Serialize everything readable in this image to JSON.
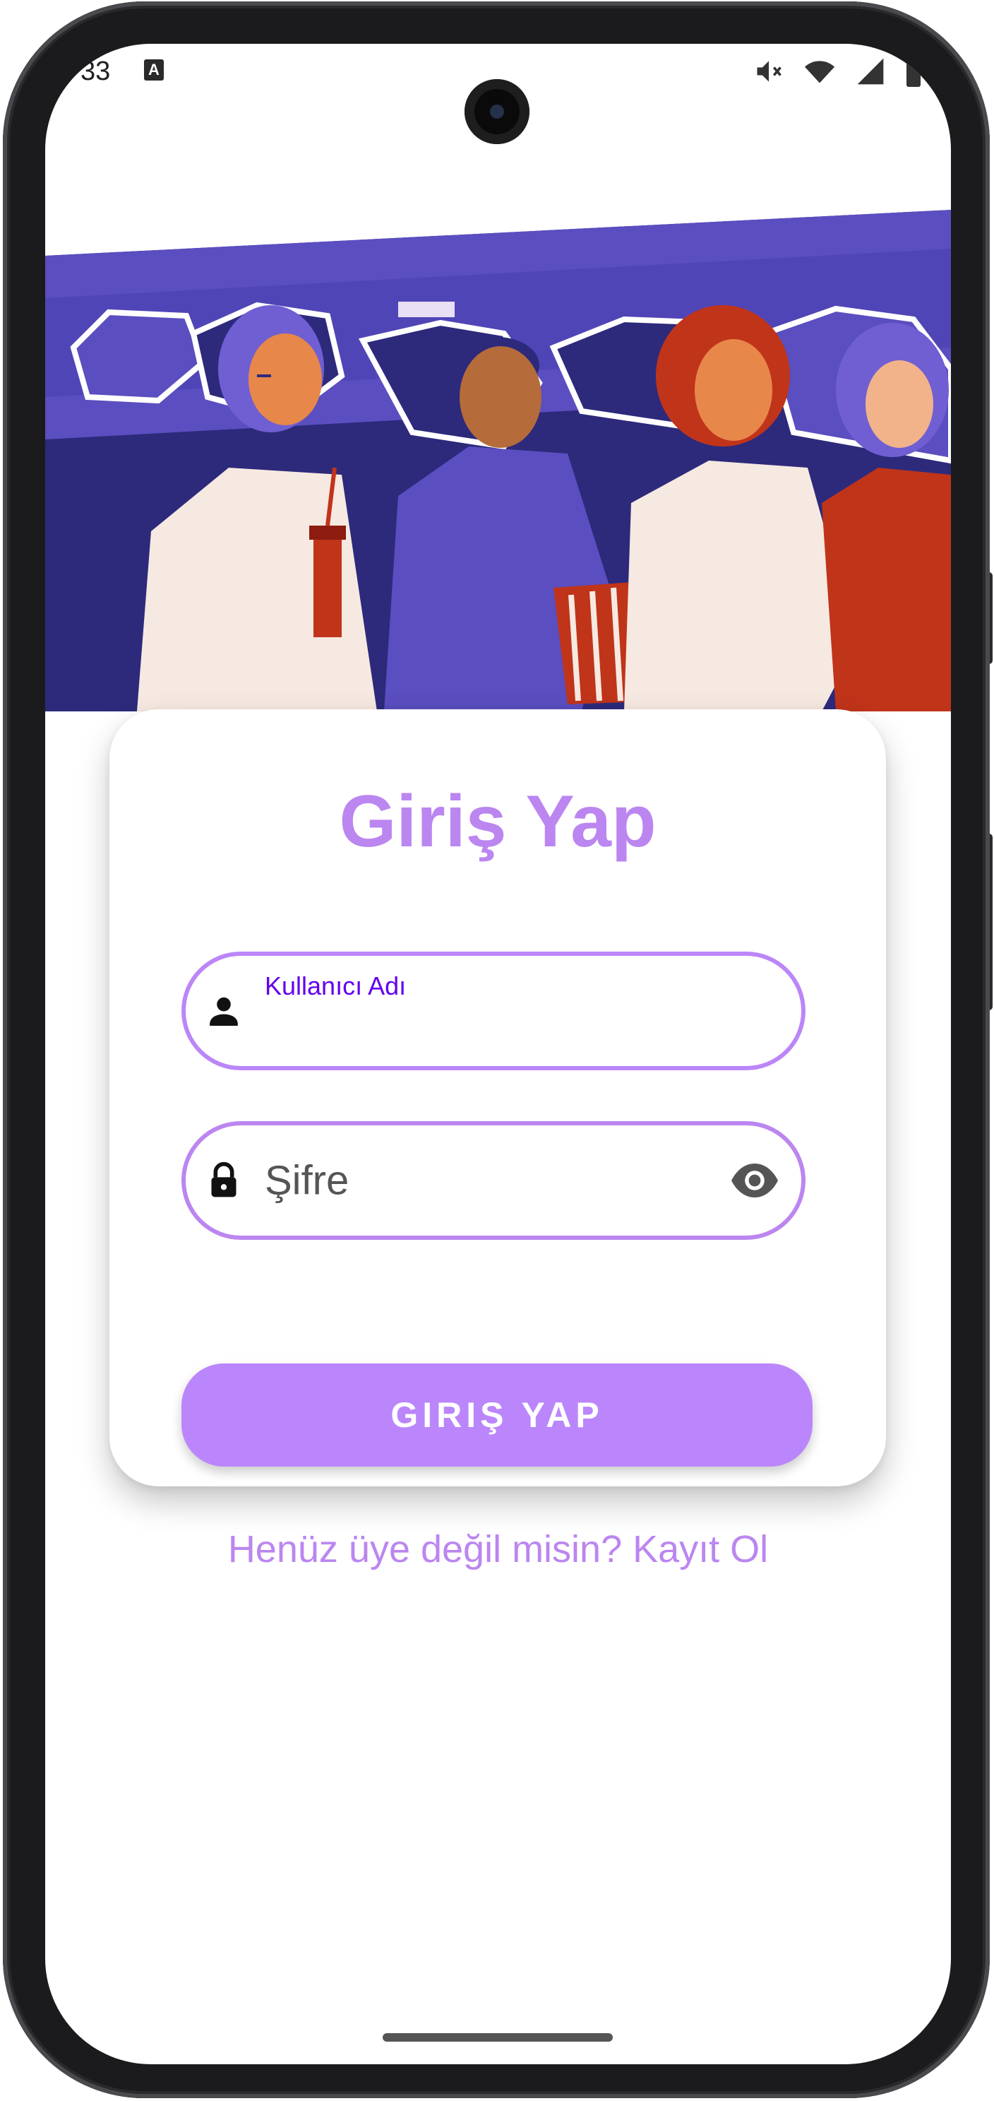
{
  "status_bar": {
    "time": "33",
    "keyboard_indicator": "A",
    "icons": [
      "mute-icon",
      "wifi-icon",
      "signal-icon",
      "battery-icon"
    ]
  },
  "hero": {
    "image": "cinema-audience-illustration",
    "colors": {
      "purple": "#5b4ec0",
      "dark": "#2d2a7c",
      "cream": "#f6e9e1",
      "skin": "#e8874a",
      "red": "#c0341a"
    }
  },
  "login": {
    "title": "Giriş Yap",
    "username": {
      "label": "Kullanıcı Adı",
      "value": "",
      "icon": "person-icon"
    },
    "password": {
      "placeholder": "Şifre",
      "value": "",
      "icon": "lock-icon",
      "toggle_icon": "eye-icon"
    },
    "submit_label": "GIRIŞ YAP",
    "signup_text": "Henüz üye değil misin? Kayıt Ol"
  },
  "colors": {
    "accent": "#bb86fc",
    "title": "#bb86f0",
    "label": "#6200ee",
    "background": "#ffffff"
  }
}
